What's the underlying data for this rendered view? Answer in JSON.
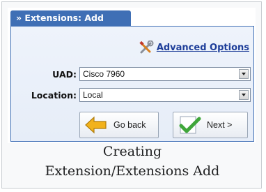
{
  "header": {
    "title": "» Extensions: Add"
  },
  "advanced": {
    "label": "Advanced Options",
    "icon": "tools-icon"
  },
  "fields": {
    "uad": {
      "label": "UAD:",
      "value": "Cisco 7960"
    },
    "location": {
      "label": "Location:",
      "value": "Local"
    }
  },
  "buttons": {
    "back": {
      "label": "Go back",
      "icon": "arrow-left-icon"
    },
    "next": {
      "label": "Next >",
      "icon": "checkmark-icon"
    }
  },
  "caption": {
    "line1": "Creating",
    "line2": "Extension/Extensions Add"
  },
  "colors": {
    "header_bg": "#3f6fb5",
    "link": "#1f3f9a",
    "check": "#3fa63a",
    "arrow": "#f2b21b"
  }
}
